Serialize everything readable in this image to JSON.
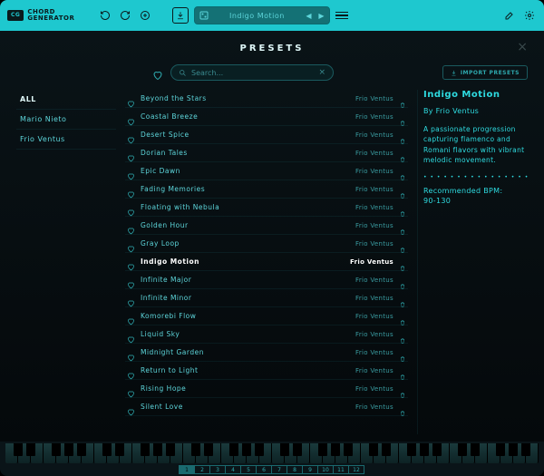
{
  "app": {
    "logo_abbr": "CG",
    "logo_text": "CHORD\nGENERATOR"
  },
  "topbar": {
    "current_preset": "Indigo Motion"
  },
  "panel": {
    "title": "PRESETS",
    "search_placeholder": "Search...",
    "import_label": "IMPORT PRESETS"
  },
  "authors": [
    {
      "label": "ALL",
      "active": true
    },
    {
      "label": "Mario Nieto",
      "active": false
    },
    {
      "label": "Frio Ventus",
      "active": false
    }
  ],
  "presets": [
    {
      "name": "Beyond the Stars",
      "author": "Frio Ventus",
      "selected": false
    },
    {
      "name": "Coastal Breeze",
      "author": "Frio Ventus",
      "selected": false
    },
    {
      "name": "Desert Spice",
      "author": "Frio Ventus",
      "selected": false
    },
    {
      "name": "Dorian Tales",
      "author": "Frio Ventus",
      "selected": false
    },
    {
      "name": "Epic Dawn",
      "author": "Frio Ventus",
      "selected": false
    },
    {
      "name": "Fading Memories",
      "author": "Frio Ventus",
      "selected": false
    },
    {
      "name": "Floating with Nebula",
      "author": "Frio Ventus",
      "selected": false
    },
    {
      "name": "Golden Hour",
      "author": "Frio Ventus",
      "selected": false
    },
    {
      "name": "Gray Loop",
      "author": "Frio Ventus",
      "selected": false
    },
    {
      "name": "Indigo Motion",
      "author": "Frio Ventus",
      "selected": true
    },
    {
      "name": "Infinite Major",
      "author": "Frio Ventus",
      "selected": false
    },
    {
      "name": "Infinite Minor",
      "author": "Frio Ventus",
      "selected": false
    },
    {
      "name": "Komorebi Flow",
      "author": "Frio Ventus",
      "selected": false
    },
    {
      "name": "Liquid Sky",
      "author": "Frio Ventus",
      "selected": false
    },
    {
      "name": "Midnight Garden",
      "author": "Frio Ventus",
      "selected": false
    },
    {
      "name": "Return to Light",
      "author": "Frio Ventus",
      "selected": false
    },
    {
      "name": "Rising Hope",
      "author": "Frio Ventus",
      "selected": false
    },
    {
      "name": "Silent Love",
      "author": "Frio Ventus",
      "selected": false
    }
  ],
  "details": {
    "title": "Indigo Motion",
    "author_line": "By Frio Ventus",
    "description": "A passionate progression capturing flamenco and Romani flavors with vibrant melodic movement.",
    "bpm_label": "Recommended BPM:",
    "bpm_value": "90-130"
  },
  "pager": {
    "pages": [
      "1",
      "2",
      "3",
      "4",
      "5",
      "6",
      "7",
      "8",
      "9",
      "10",
      "11",
      "12"
    ],
    "active": 0
  }
}
